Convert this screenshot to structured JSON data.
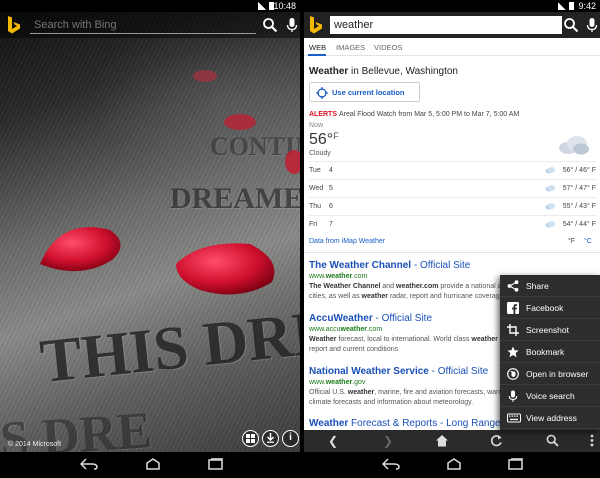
{
  "left": {
    "status_time": "10:48",
    "search_placeholder": "Search with Bing",
    "engraving": [
      "CONTIN",
      "DREAMER",
      "THIS DRE",
      "IS DRE"
    ],
    "copyright": "© 2014 Microsoft"
  },
  "right": {
    "status_time": "9:42",
    "search_value": "weather",
    "tabs": [
      "WEB",
      "IMAGES",
      "VIDEOS"
    ],
    "weather": {
      "title_bold": "Weather",
      "title_rest": " in Bellevue, Washington",
      "location_button": "Use current location",
      "alert_tag": "ALERTS",
      "alert_text": "Areal Flood Watch from Mar 5, 5:00 PM to Mar 7, 5:00 AM",
      "now_label": "Now",
      "temp": "56°",
      "temp_unit": "F",
      "condition": "Cloudy",
      "forecast": [
        {
          "day": "Tue",
          "date": "4",
          "temps": "56° / 46° F"
        },
        {
          "day": "Wed",
          "date": "5",
          "temps": "57° / 47° F"
        },
        {
          "day": "Thu",
          "date": "6",
          "temps": "55° / 43° F"
        },
        {
          "day": "Fri",
          "date": "7",
          "temps": "54° / 44° F"
        }
      ],
      "data_source": "Data from iMap Weather",
      "unit_f": "°F",
      "unit_c": "°C"
    },
    "results": [
      {
        "title_bold": "The Weather Channel",
        "title_rest": " - Official Site",
        "url_plain": "www.",
        "url_bold": "weather",
        "url_tail": ".com",
        "snippet": "The Weather Channel and weather.com provide a national and local weather forecast for cities, as well as weather radar, report and hurricane coverage"
      },
      {
        "title_bold": "AccuWeather",
        "title_rest": " - Official Site",
        "url_plain": "www.accu",
        "url_bold": "weather",
        "url_tail": ".com",
        "snippet": "Weather forecast, local to international. World class weather forecasting. Local weather report and current conditions"
      },
      {
        "title_bold": "National Weather Service",
        "title_rest": " - Official Site",
        "url_plain": "www.",
        "url_bold": "weather",
        "url_tail": ".gov",
        "snippet": "Official U.S. weather, marine, fire and aviation forecasts, warnings, meteorological data, climate forecasts and information about meteorology."
      },
      {
        "title_bold": "Weather",
        "title_rest": " Forecast & Reports - Long Range & Local"
      }
    ],
    "menu": [
      {
        "label": "Share",
        "icon": "share-icon"
      },
      {
        "label": "Facebook",
        "icon": "facebook-icon"
      },
      {
        "label": "Screenshot",
        "icon": "screenshot-icon"
      },
      {
        "label": "Bookmark",
        "icon": "star-icon"
      },
      {
        "label": "Open in browser",
        "icon": "globe-icon"
      },
      {
        "label": "Voice search",
        "icon": "microphone-icon"
      },
      {
        "label": "View address",
        "icon": "keyboard-icon"
      }
    ]
  },
  "colors": {
    "link_blue": "#1a4fb8",
    "url_green": "#1a7a1a",
    "alert_red": "#dd1122",
    "bing_yellow": "#f5b800"
  }
}
